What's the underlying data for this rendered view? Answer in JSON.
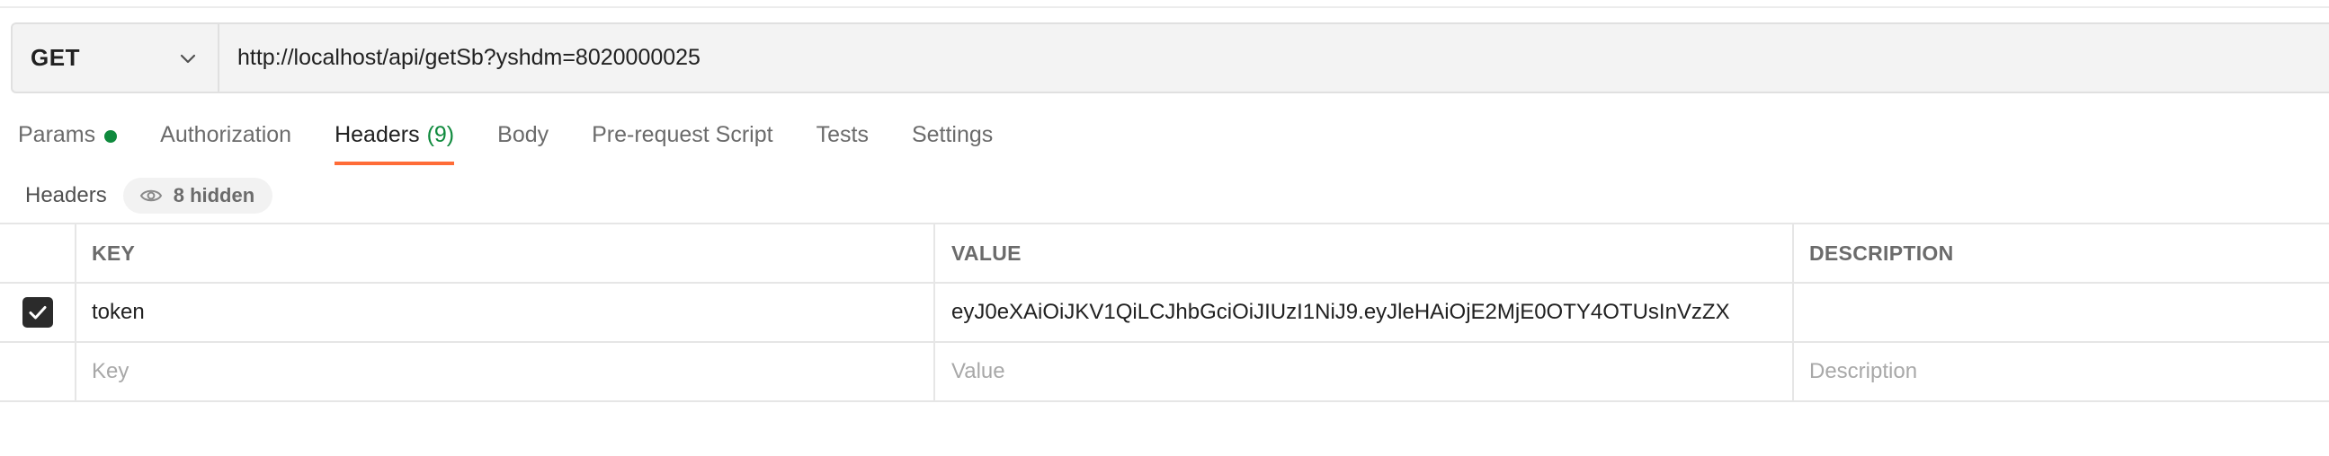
{
  "request": {
    "method": "GET",
    "url": "http://localhost/api/getSb?yshdm=8020000025"
  },
  "tabs": [
    {
      "label": "Params",
      "indicator": "green-dot"
    },
    {
      "label": "Authorization"
    },
    {
      "label": "Headers",
      "count": "(9)",
      "active": true
    },
    {
      "label": "Body"
    },
    {
      "label": "Pre-request Script"
    },
    {
      "label": "Tests"
    },
    {
      "label": "Settings"
    }
  ],
  "headers_section": {
    "title": "Headers",
    "hidden_label": "8 hidden",
    "hidden_icon": "eye-icon"
  },
  "table": {
    "columns": {
      "key": "KEY",
      "value": "VALUE",
      "description": "DESCRIPTION"
    },
    "rows": [
      {
        "checked": true,
        "key": "token",
        "value": "eyJ0eXAiOiJKV1QiLCJhbGciOiJIUzI1NiJ9.eyJleHAiOjE2MjE0OTY4OTUsInVzZX",
        "description": ""
      }
    ],
    "empty_row": {
      "key_placeholder": "Key",
      "value_placeholder": "Value",
      "description_placeholder": "Description"
    }
  },
  "colors": {
    "accent": "#ff6c37",
    "status_green": "#0f8a3d"
  }
}
